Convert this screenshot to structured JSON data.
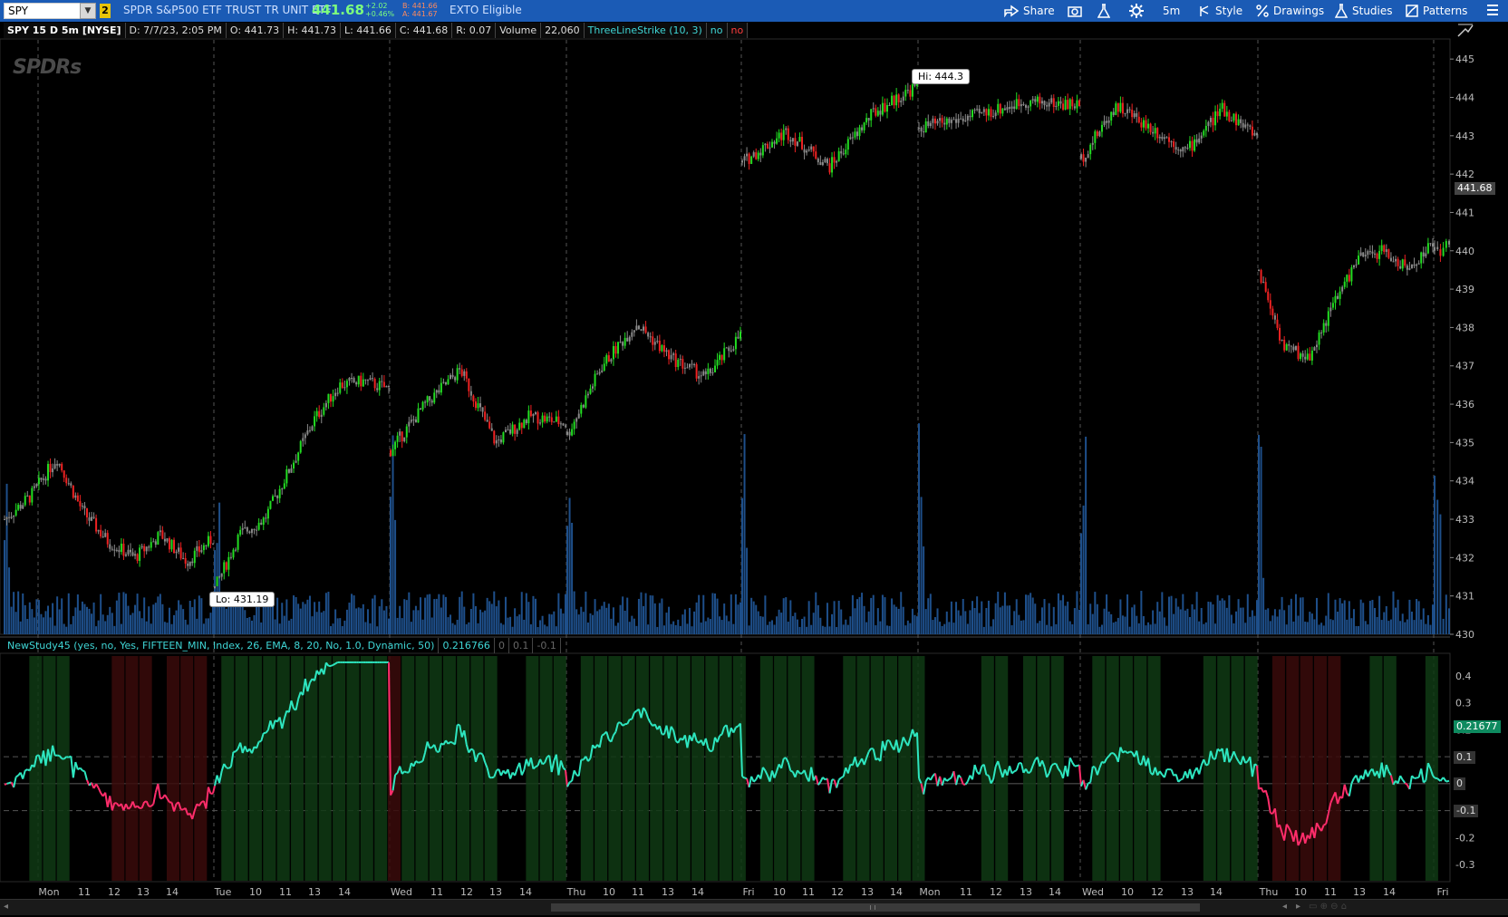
{
  "toolbar": {
    "symbol": "SPY",
    "link_badge": "2",
    "description": "SPDR S&P500 ETF TRUST TR UNIT ETF",
    "last_price": "441.68",
    "change_abs": "+2.02",
    "change_pct": "+0.46%",
    "bid": "B: 441.66",
    "ask": "A: 441.67",
    "exto": "EXTO Eligible",
    "share_label": "Share",
    "timeframe_label": "5m",
    "style_label": "Style",
    "drawings_label": "Drawings",
    "studies_label": "Studies",
    "patterns_label": "Patterns"
  },
  "header": {
    "chart_id": "SPY 15 D 5m [NYSE]",
    "date": "D: 7/7/23, 2:05 PM",
    "open": "O: 441.73",
    "high": "H: 441.73",
    "low": "L: 441.66",
    "close": "C: 441.68",
    "range": "R: 0.07",
    "volume_label": "Volume",
    "volume_value": "22,060",
    "study_name": "ThreeLineStrike (10, 3)",
    "study_flag1": "no",
    "study_flag2": "no"
  },
  "lower_header": {
    "study": "NewStudy45 (yes, no, Yes, FIFTEEN_MIN, Index, 26, EMA, 8, 20, No, 1.0, Dynamic, 50)",
    "value": "0.216766",
    "v0": "0",
    "v1": "0.1",
    "v2": "-0.1"
  },
  "callouts": {
    "high": "Hi: 444.3",
    "low": "Lo: 431.19"
  },
  "logo_text": "SPDRs",
  "axis_tags": {
    "price": "441.68",
    "osc": "0.21677",
    "osc_p01": "0.1",
    "osc_0": "0",
    "osc_m01": "-0.1"
  },
  "colors": {
    "toolbar_bg": "#1b5bb5",
    "up": "#22dd22",
    "down": "#ee2222",
    "neutral": "#8a8a8a",
    "volume": "#1e4f8a",
    "osc_pos": "#2ee6c0",
    "osc_neg": "#ff2d6b"
  },
  "chart_data": {
    "type": "candlestick",
    "price_axis_ticks": [
      "445",
      "444",
      "443",
      "442",
      "441",
      "440",
      "439",
      "438",
      "437",
      "436",
      "435",
      "434",
      "433",
      "432",
      "431",
      "430"
    ],
    "price_range": [
      430,
      445.5
    ],
    "osc_axis_ticks": [
      "0.4",
      "0.3",
      "0.2",
      "0.1",
      "0",
      "-0.1",
      "-0.2",
      "-0.3"
    ],
    "osc_range": [
      -0.36,
      0.48
    ],
    "x_labels": [
      "Mon",
      "11",
      "12",
      "13",
      "14",
      "Tue",
      "10",
      "11",
      "13",
      "14",
      "Wed",
      "11",
      "12",
      "13",
      "14",
      "Thu",
      "10",
      "11",
      "13",
      "14",
      "Fri",
      "10",
      "11",
      "12",
      "13",
      "14",
      "Mon",
      "11",
      "12",
      "13",
      "14",
      "Wed",
      "10",
      "12",
      "13",
      "14",
      "Thu",
      "10",
      "11",
      "13",
      "14",
      "Fri"
    ],
    "sessions": [
      {
        "day": "Mon",
        "path": [
          433.0,
          433.6,
          434.6,
          433.2,
          432.4,
          432.0,
          432.6,
          431.9,
          432.5
        ]
      },
      {
        "day": "Tue",
        "path": [
          431.2,
          432.6,
          433.0,
          434.3,
          435.6,
          436.5,
          436.6,
          436.4
        ]
      },
      {
        "day": "Wed",
        "path": [
          434.8,
          436.0,
          436.9,
          435.0,
          435.7,
          435.5
        ]
      },
      {
        "day": "Thu",
        "path": [
          435.2,
          437.0,
          438.1,
          437.2,
          436.7,
          437.8
        ]
      },
      {
        "day": "Fri",
        "path": [
          442.3,
          443.1,
          442.2,
          443.6,
          444.3
        ]
      },
      {
        "day": "Mon",
        "path": [
          443.2,
          443.5,
          443.9,
          443.8
        ]
      },
      {
        "day": "Wed",
        "path": [
          442.4,
          443.8,
          443.2,
          442.6,
          443.7,
          443.0
        ]
      },
      {
        "day": "Thu",
        "path": [
          439.5,
          437.5,
          437.2,
          438.6,
          439.8,
          440.0,
          439.5,
          440.2
        ]
      },
      {
        "day": "Fri",
        "path": [
          440.0,
          440.1
        ]
      }
    ],
    "high": 444.3,
    "low": 431.19,
    "last": 441.68,
    "osc_last": 0.21677
  }
}
